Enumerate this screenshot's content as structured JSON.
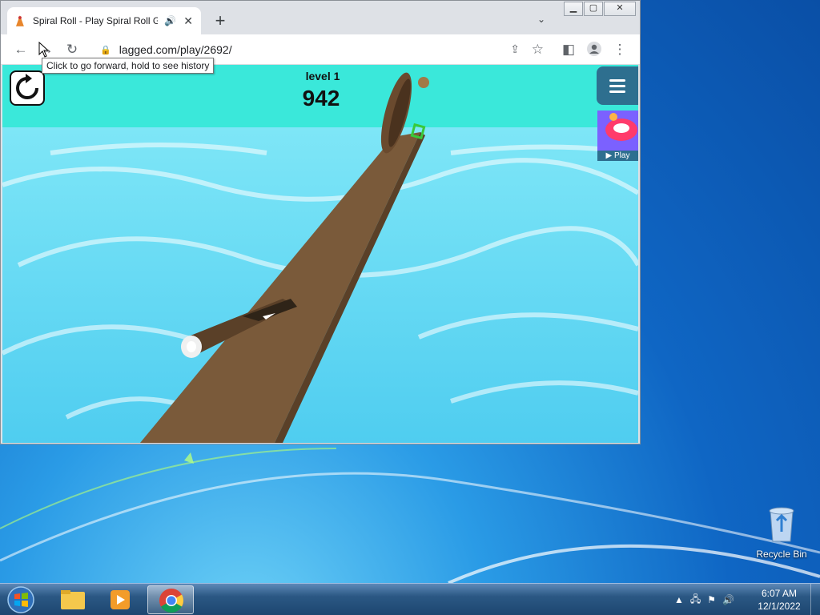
{
  "browser": {
    "tab_title": "Spiral Roll - Play Spiral Roll G",
    "audio_icon": "speaker-icon",
    "close_glyph": "✕",
    "new_tab_glyph": "+",
    "url": "lagged.com/play/2692/",
    "tooltip": "Click to go forward, hold to see history"
  },
  "game": {
    "level_label": "level 1",
    "score": "942",
    "promo_label": "▶ Play"
  },
  "desktop": {
    "recycle_bin_label": "Recycle Bin"
  },
  "taskbar": {
    "time": "6:07 AM",
    "date": "12/1/2022"
  },
  "colors": {
    "sky": "#3ae8da",
    "water": "#5fd6f2",
    "plank": "#7a5a3a",
    "menu_bg": "#2e6f8f"
  }
}
